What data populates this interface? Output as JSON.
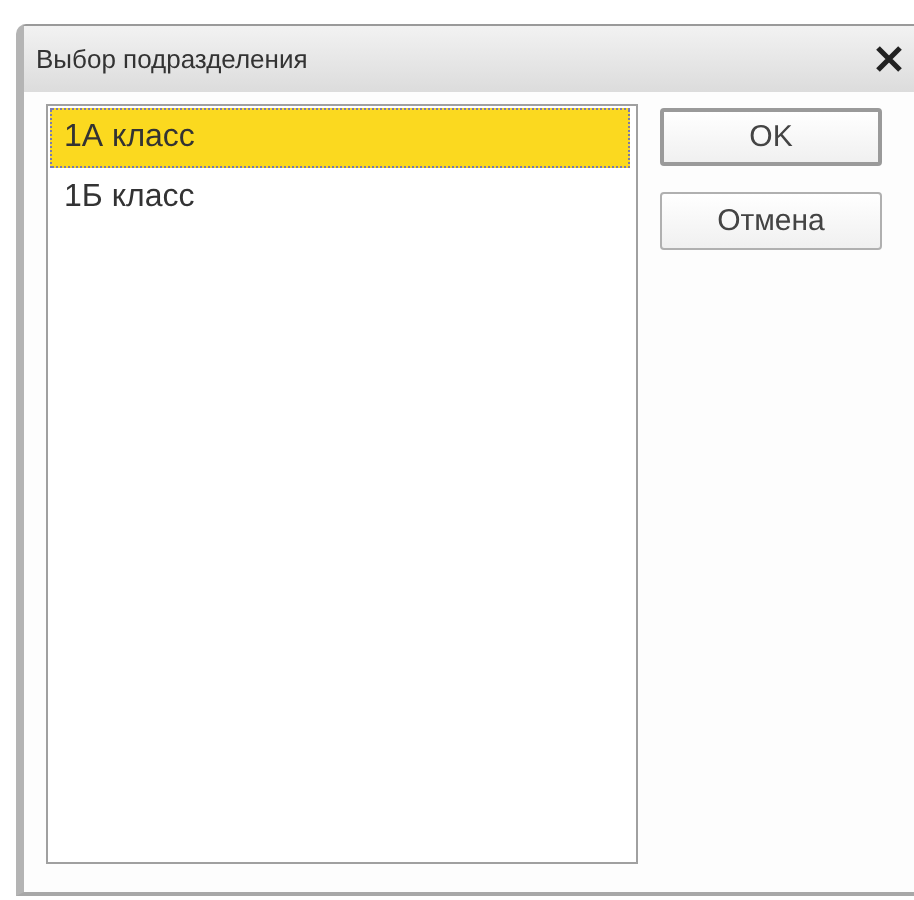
{
  "window": {
    "title": "Выбор подразделения"
  },
  "list": {
    "items": [
      {
        "label": "1А класс",
        "selected": true
      },
      {
        "label": "1Б класс",
        "selected": false
      }
    ]
  },
  "buttons": [
    {
      "label": "OK",
      "kind": "default"
    },
    {
      "label": "Отмена",
      "kind": "normal"
    }
  ]
}
